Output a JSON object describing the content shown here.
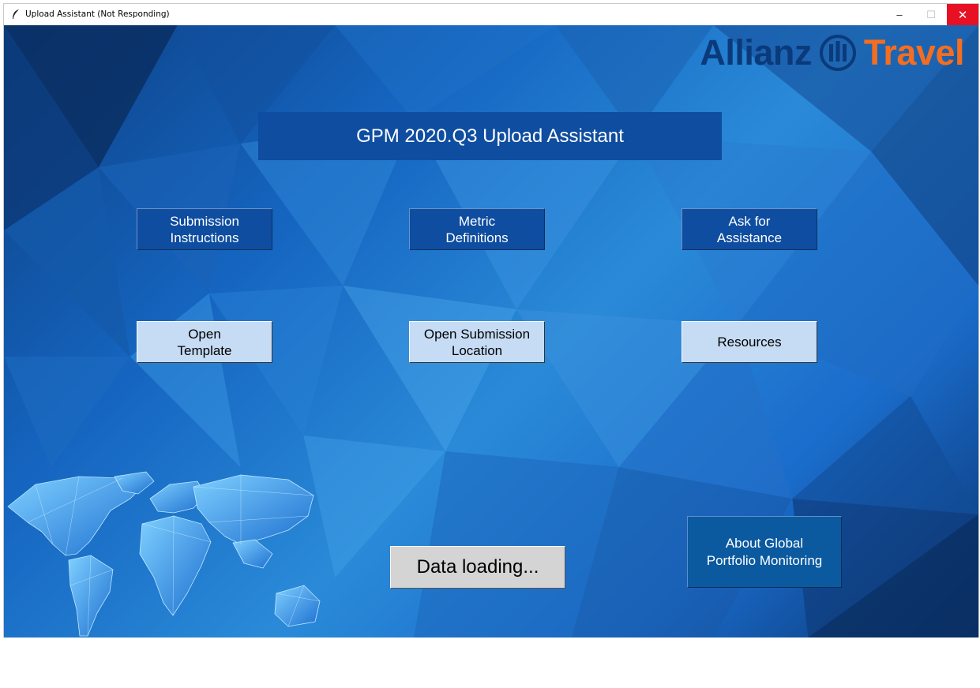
{
  "window": {
    "title": "Upload Assistant (Not Responding)",
    "minimize_glyph": "–",
    "maximize_glyph": "☐",
    "close_glyph": "✕"
  },
  "brand": {
    "allianz": "Allianz",
    "travel": "Travel",
    "colors": {
      "allianz": "#0b3a7a",
      "travel": "#f36e21"
    }
  },
  "header": {
    "title": "GPM 2020.Q3 Upload Assistant"
  },
  "buttons": {
    "submission_instructions": "Submission\nInstructions",
    "metric_definitions": "Metric\nDefinitions",
    "ask_for_assistance": "Ask for\nAssistance",
    "open_template": "Open\nTemplate",
    "open_submission_location": "Open Submission\nLocation",
    "resources": "Resources",
    "data_loading": "Data loading...",
    "about": "About Global\nPortfolio Monitoring"
  },
  "colors": {
    "dark_button": "#0e4da0",
    "light_button": "#c6dcf4",
    "loading_button": "#d4d4d4",
    "close_button": "#e81123"
  }
}
